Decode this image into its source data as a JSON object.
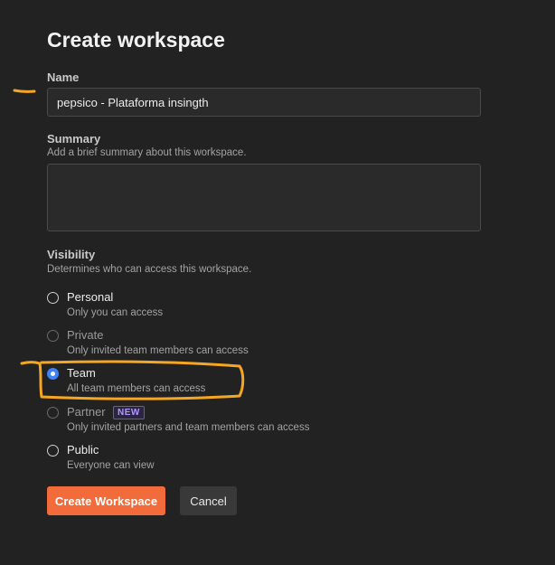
{
  "dialog": {
    "title": "Create workspace"
  },
  "name_field": {
    "label": "Name",
    "value": "pepsico - Plataforma insingth",
    "placeholder": ""
  },
  "summary_field": {
    "label": "Summary",
    "help": "Add a brief summary about this workspace.",
    "value": ""
  },
  "visibility": {
    "label": "Visibility",
    "help": "Determines who can access this workspace.",
    "selected": "Team",
    "options": [
      {
        "label": "Personal",
        "description": "Only you can access",
        "dimmed": false
      },
      {
        "label": "Private",
        "description": "Only invited team members can access",
        "dimmed": true
      },
      {
        "label": "Team",
        "description": "All team members can access",
        "dimmed": false
      },
      {
        "label": "Partner",
        "description": "Only invited partners and team members can access",
        "dimmed": true,
        "badge": "NEW"
      },
      {
        "label": "Public",
        "description": "Everyone can view",
        "dimmed": false
      }
    ]
  },
  "actions": {
    "create_label": "Create Workspace",
    "cancel_label": "Cancel"
  },
  "colors": {
    "background": "#222222",
    "primary_button": "#f26b3a",
    "radio_selected": "#3d82f6",
    "badge": "#b497ff",
    "annotation": "#f5a623"
  }
}
